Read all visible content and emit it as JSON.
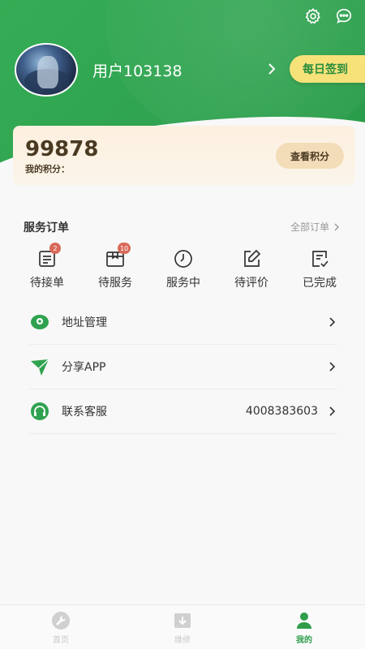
{
  "header": {
    "username": "用户103138",
    "checkin_label": "每日签到"
  },
  "icons": {
    "settings": "gear-icon",
    "message": "chat-bubble-icon"
  },
  "points": {
    "value": "99878",
    "label": "我的积分：",
    "view_button": "查看积分"
  },
  "orders": {
    "title": "服务订单",
    "all_label": "全部订单",
    "items": [
      {
        "label": "待接单",
        "badge": "2",
        "icon": "pending-order-icon"
      },
      {
        "label": "待服务",
        "badge": "10",
        "icon": "box-icon"
      },
      {
        "label": "服务中",
        "badge": "",
        "icon": "clock-icon"
      },
      {
        "label": "待评价",
        "badge": "",
        "icon": "edit-icon"
      },
      {
        "label": "已完成",
        "badge": "",
        "icon": "checklist-icon"
      }
    ]
  },
  "menu": [
    {
      "label": "地址管理",
      "value": "",
      "icon": "location-icon"
    },
    {
      "label": "分享APP",
      "value": "",
      "icon": "send-icon"
    },
    {
      "label": "联系客服",
      "value": "4008383603",
      "icon": "headset-icon"
    }
  ],
  "tabbar": [
    {
      "label": "首页",
      "active": false
    },
    {
      "label": "维修",
      "active": false
    },
    {
      "label": "我的",
      "active": true
    }
  ],
  "colors": {
    "brand_green": "#2fa24f",
    "checkin_yellow": "#f7e27a",
    "badge_red": "#d96a5a"
  }
}
